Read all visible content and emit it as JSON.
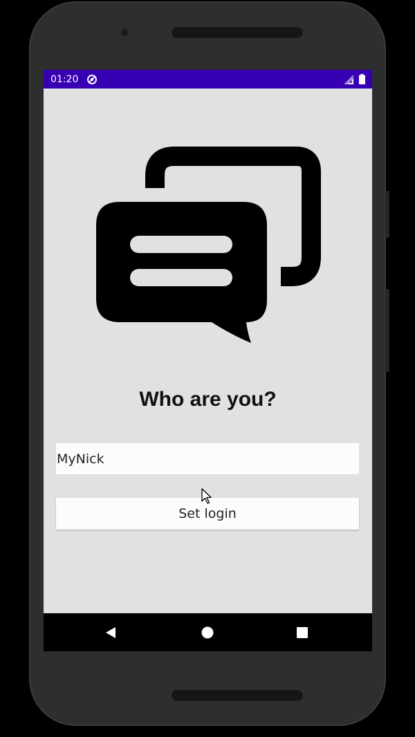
{
  "status_bar": {
    "time": "01:20",
    "background_color": "#3700b3",
    "icons": [
      "sync-icon",
      "signal-icon",
      "battery-icon"
    ]
  },
  "main": {
    "logo_icon": "chat-bubbles-icon",
    "title": "Who are you?",
    "nick_input": {
      "value": "MyNick",
      "placeholder": ""
    },
    "set_login_label": "Set login"
  },
  "nav_bar": {
    "buttons": [
      "back-icon",
      "home-icon",
      "recents-icon"
    ]
  },
  "colors": {
    "screen_background": "#e1e0e3",
    "accent": "#3700b3"
  }
}
